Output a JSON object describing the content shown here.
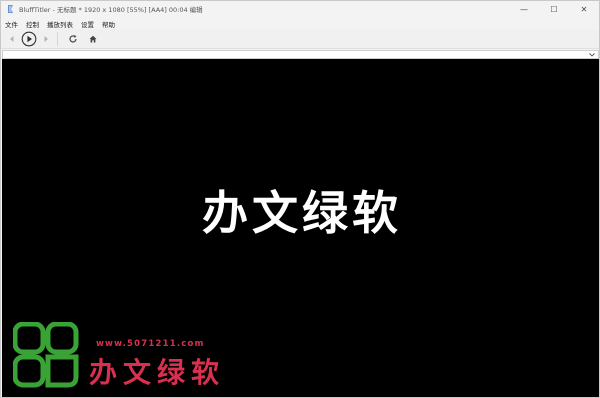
{
  "window": {
    "title": "BluffTitler - 无标题 * 1920 x 1080 [55%] [AA4] 00:04 编辑",
    "controls": {
      "minimize": "—",
      "maximize": "☐",
      "close": "✕"
    }
  },
  "menubar": {
    "items": [
      {
        "label": "文件"
      },
      {
        "label": "控制"
      },
      {
        "label": "播放列表"
      },
      {
        "label": "设置"
      },
      {
        "label": "帮助"
      }
    ]
  },
  "toolbar": {
    "icons": [
      "rewind-icon",
      "play-icon",
      "forward-icon",
      "reload-icon",
      "home-icon"
    ]
  },
  "canvas": {
    "text": "办文绿软",
    "background": "#000000",
    "text_color": "#ffffff"
  },
  "watermark": {
    "url": "www.5071211.com",
    "name": "办文绿软",
    "brand_color": "#d9304f",
    "logo_color": "#3aa335"
  }
}
